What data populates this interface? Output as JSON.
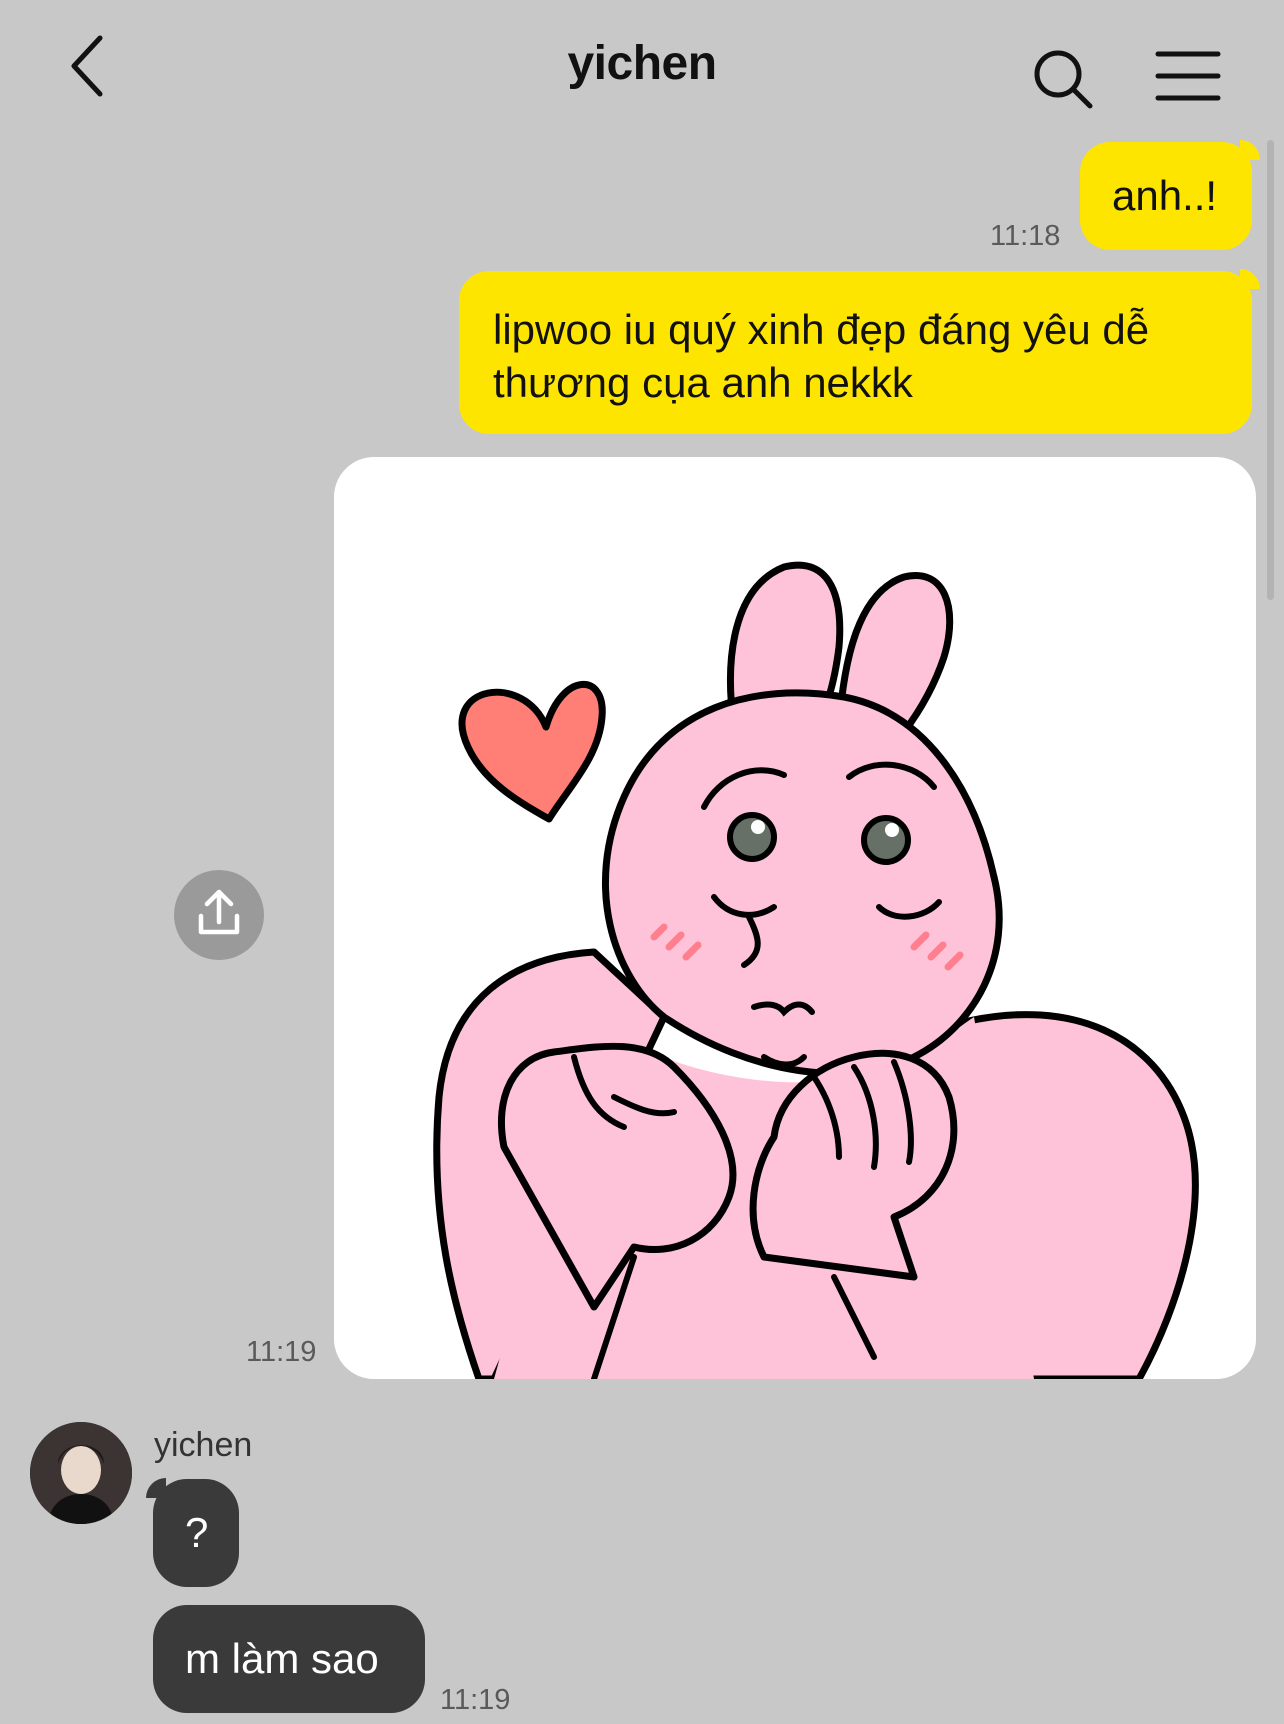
{
  "header": {
    "title": "yichen",
    "back_icon": "chevron-left-icon",
    "search_icon": "search-icon",
    "menu_icon": "hamburger-menu-icon"
  },
  "messages": {
    "outgoing": [
      {
        "text": "anh..!",
        "time": "11:18"
      },
      {
        "text": "lipwoo iu quý xinh đẹp đáng yêu dễ thương cụa anh nekkk"
      }
    ],
    "sticker": {
      "time": "11:19",
      "share_icon": "share-upload-icon"
    },
    "incoming": {
      "sender": "yichen",
      "items": [
        {
          "text": "?"
        },
        {
          "text": "m làm sao",
          "time": "11:19"
        }
      ]
    }
  },
  "colors": {
    "background": "#c8c8c8",
    "outgoing_bubble": "#fee500",
    "incoming_bubble": "#3a3a3a",
    "sticker_pink": "#ffc3d9",
    "heart": "#ff7f76"
  }
}
